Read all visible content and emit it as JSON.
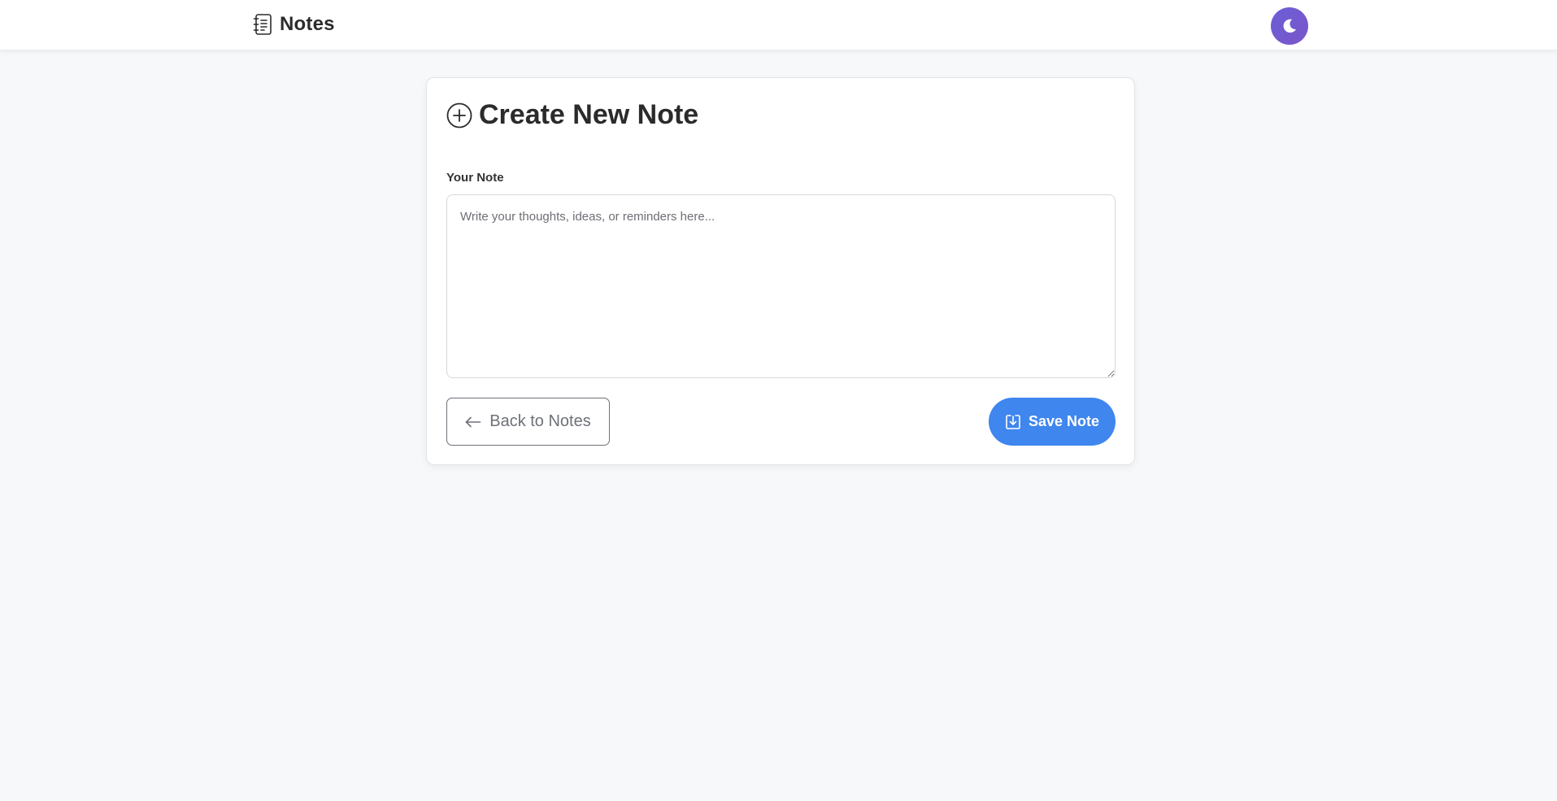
{
  "navbar": {
    "brand_title": "Notes",
    "brand_icon": "journal-text-icon",
    "theme_toggle_icon": "moon-icon"
  },
  "form": {
    "title": "Create New Note",
    "title_icon": "plus-circle-icon",
    "note_label": "Your Note",
    "note_value": "",
    "note_placeholder": "Write your thoughts, ideas, or reminders here...",
    "back_label": "Back to Notes",
    "back_icon": "arrow-left-icon",
    "save_label": "Save Note",
    "save_icon": "save-download-icon"
  },
  "colors": {
    "background": "#f7f8fa",
    "primary": "#3f86ee",
    "theme_toggle": "#6b5fd6",
    "text": "#2b2b2b",
    "secondary": "#6e7178"
  }
}
